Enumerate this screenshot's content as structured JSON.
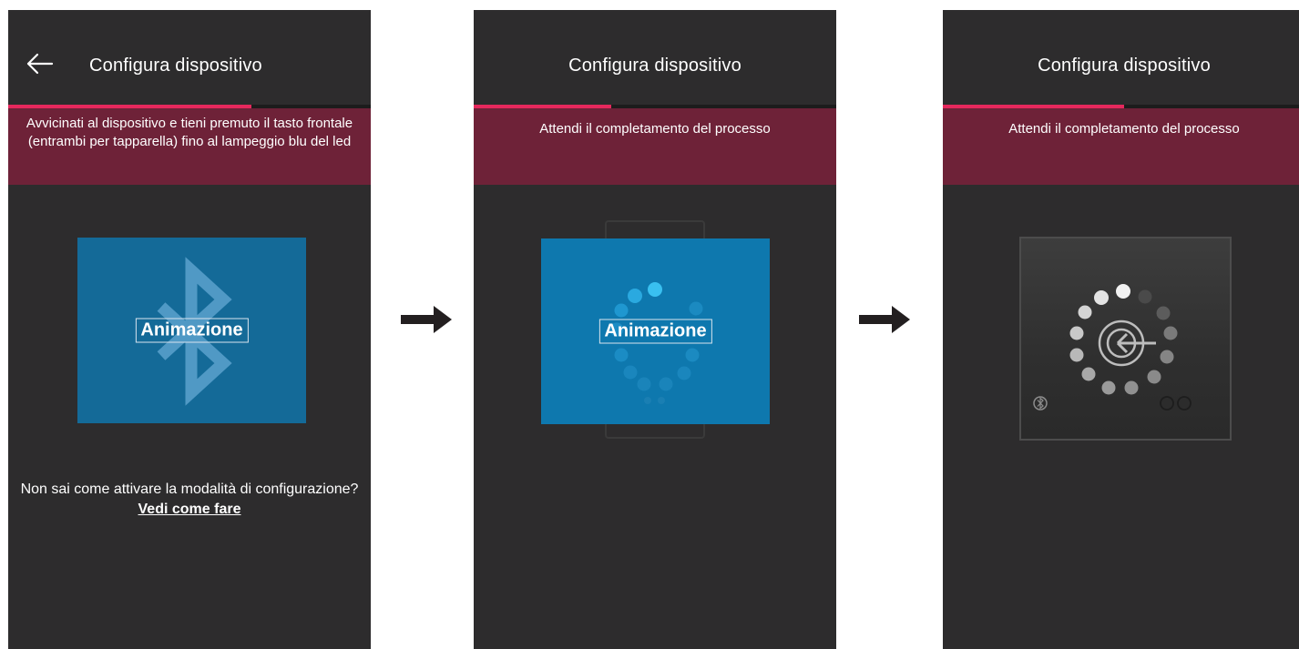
{
  "screens": [
    {
      "title": "Configura dispositivo",
      "progress": 0.67,
      "banner": "Avvicinati al dispositivo e tieni premuto il tasto frontale (entrambi per tapparella) fino al lampeggio blu del led",
      "animation_label": "Animazione",
      "help_text": "Non sai come attivare la modalità di configurazione?",
      "help_link": "Vedi come fare"
    },
    {
      "title": "Configura dispositivo",
      "progress": 0.38,
      "banner": "Attendi il completamento del processo",
      "animation_label": "Animazione"
    },
    {
      "title": "Configura dispositivo",
      "progress": 0.5,
      "banner": "Attendi il completamento del processo"
    }
  ],
  "icons": [
    "back-arrow-icon",
    "bluetooth-icon",
    "spinner-icon",
    "arrow-right-icon",
    "sync-target-icon",
    "bluetooth-small-icon"
  ],
  "colors": {
    "accent": "#e6285d",
    "banner": "#6e2238",
    "screen_bg": "#2d2c2d",
    "card_blue": "#146a98"
  }
}
